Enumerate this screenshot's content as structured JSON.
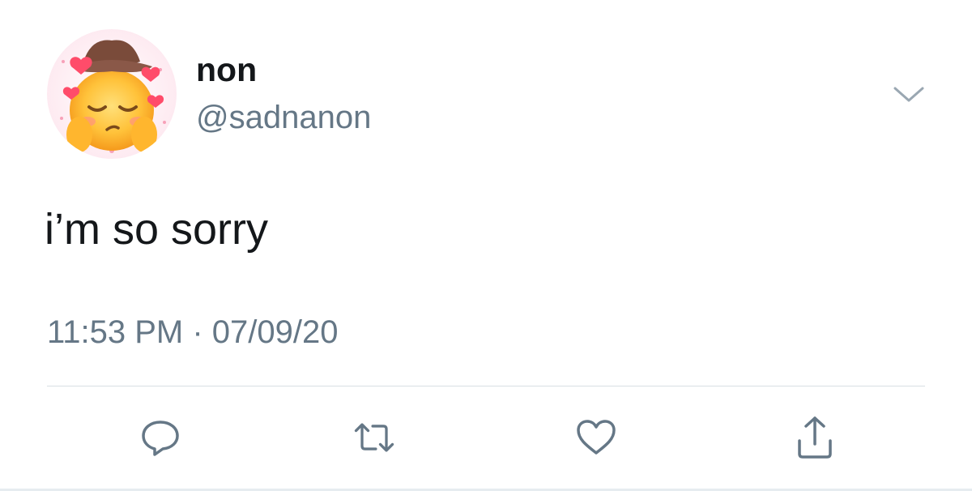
{
  "tweet": {
    "display_name": "non",
    "handle": "@sadnanon",
    "text": "i’m so sorry",
    "timestamp": "11:53 PM · 07/09/20"
  },
  "icons": {
    "menu": "chevron-down-icon",
    "avatar": "emoji-avatar-image",
    "reply": "reply-icon",
    "retweet": "retweet-icon",
    "like": "heart-icon",
    "share": "share-icon"
  },
  "colors": {
    "text_primary": "#14171a",
    "text_secondary": "#657786",
    "icon_gray": "#657786",
    "divider": "#d8dfe3"
  }
}
